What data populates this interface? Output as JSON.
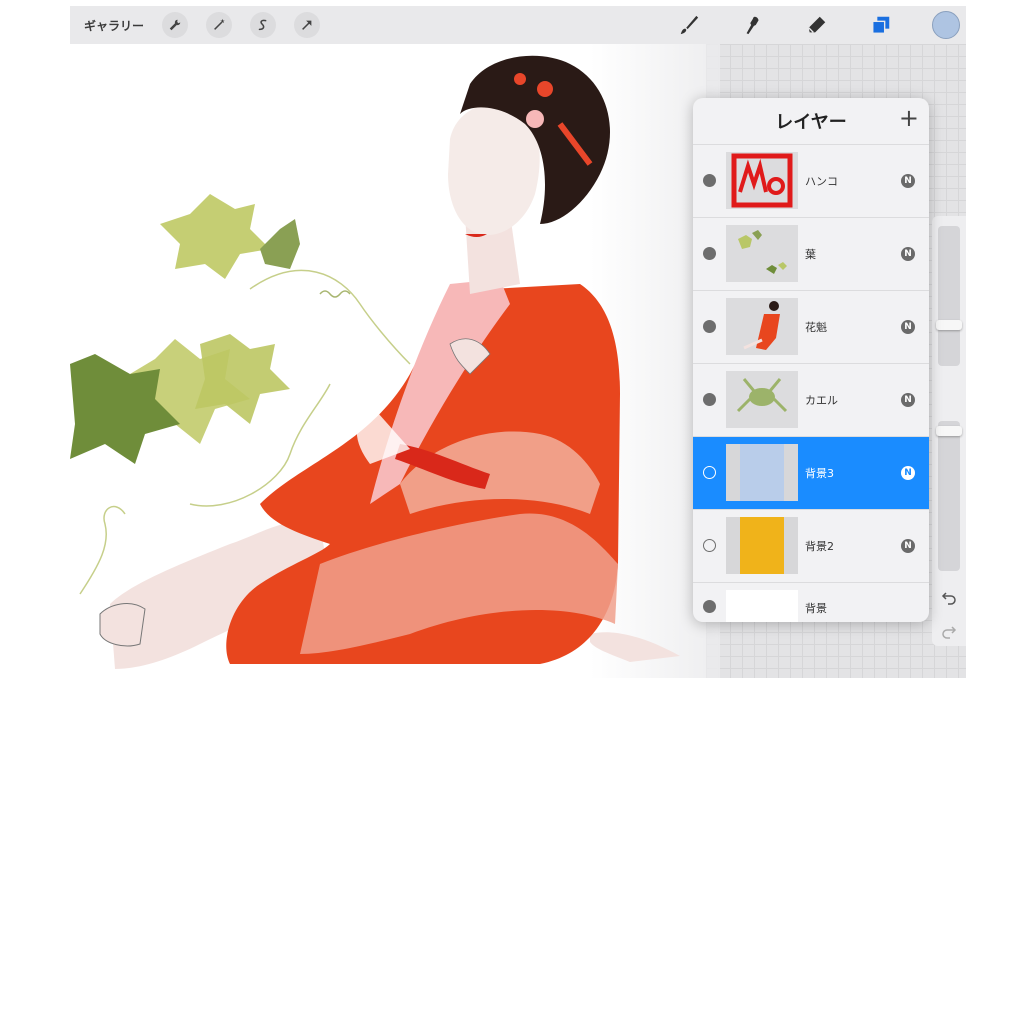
{
  "toolbar": {
    "gallery_label": "ギャラリー",
    "left_tools": [
      {
        "icon": "wrench-icon"
      },
      {
        "icon": "magic-wand-icon"
      },
      {
        "icon": "selection-icon"
      },
      {
        "icon": "transform-arrow-icon"
      }
    ],
    "right_tools": [
      {
        "icon": "brush-icon"
      },
      {
        "icon": "smudge-icon"
      },
      {
        "icon": "eraser-icon"
      },
      {
        "icon": "layers-icon",
        "active": true
      }
    ],
    "current_color": "#aec4e2",
    "active_color": "#1a6fe0"
  },
  "layers_panel": {
    "title": "レイヤー",
    "add_label": "+",
    "layers": [
      {
        "name": "ハンコ",
        "visible": true,
        "blend": "N",
        "selected": false,
        "thumb": "hanko"
      },
      {
        "name": "葉",
        "visible": true,
        "blend": "N",
        "selected": false,
        "thumb": "leaves"
      },
      {
        "name": "花魁",
        "visible": true,
        "blend": "N",
        "selected": false,
        "thumb": "oiran"
      },
      {
        "name": "カエル",
        "visible": true,
        "blend": "N",
        "selected": false,
        "thumb": "frog"
      },
      {
        "name": "背景3",
        "visible": false,
        "blend": "N",
        "selected": true,
        "thumb": "bg3",
        "thumb_color": "#b9cdea"
      },
      {
        "name": "背景2",
        "visible": false,
        "blend": "N",
        "selected": false,
        "thumb": "bg2",
        "thumb_color": "#f0b31a"
      },
      {
        "name": "背景",
        "visible": true,
        "blend": "",
        "selected": false,
        "thumb": "bg",
        "thumb_color": "#ffffff"
      }
    ]
  },
  "colors": {
    "selection": "#1a8cff",
    "kimono_red": "#e8461e",
    "leaf_green": "#bfcc66"
  }
}
